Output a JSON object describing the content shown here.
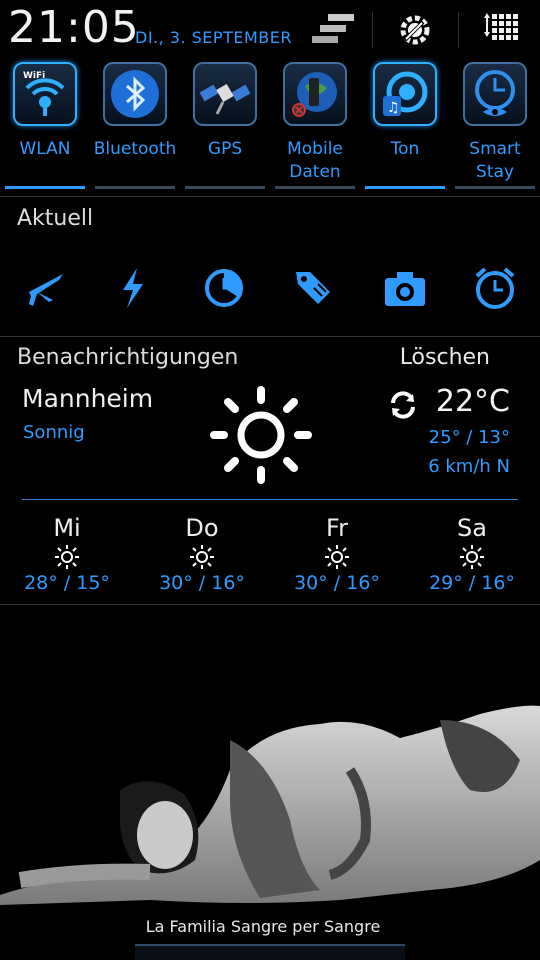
{
  "status": {
    "time": "21:05",
    "date": "DI., 3. SEPTEMBER"
  },
  "toggles": [
    {
      "label": "WLAN",
      "icon": "wifi-icon",
      "on": true
    },
    {
      "label": "Bluetooth",
      "icon": "bluetooth-icon",
      "on": false
    },
    {
      "label": "GPS",
      "icon": "satellite-icon",
      "on": false
    },
    {
      "label": "Mobile\nDaten",
      "icon": "mobile-data-icon",
      "on": false
    },
    {
      "label": "Ton",
      "icon": "sound-icon",
      "on": true
    },
    {
      "label": "Smart\nStay",
      "icon": "smart-stay-icon",
      "on": false
    }
  ],
  "current": {
    "title": "Aktuell",
    "icons": [
      "airplane-icon",
      "flash-icon",
      "clock-icon",
      "tag-icon",
      "camera-icon",
      "alarm-icon"
    ]
  },
  "notifications": {
    "title": "Benachrichtigungen",
    "clear_label": "Löschen"
  },
  "weather": {
    "city": "Mannheim",
    "condition": "Sonnig",
    "temp": "22°C",
    "hilo": "25° / 13°",
    "wind": "6 km/h N",
    "forecast": [
      {
        "day": "Mi",
        "temps": "28° / 15°"
      },
      {
        "day": "Do",
        "temps": "30° / 16°"
      },
      {
        "day": "Fr",
        "temps": "30° / 16°"
      },
      {
        "day": "Sa",
        "temps": "29° / 16°"
      }
    ]
  },
  "wallpaper": {
    "caption": "La Familia Sangre per Sangre"
  },
  "colors": {
    "accent": "#2f9bff",
    "background": "#000000"
  }
}
